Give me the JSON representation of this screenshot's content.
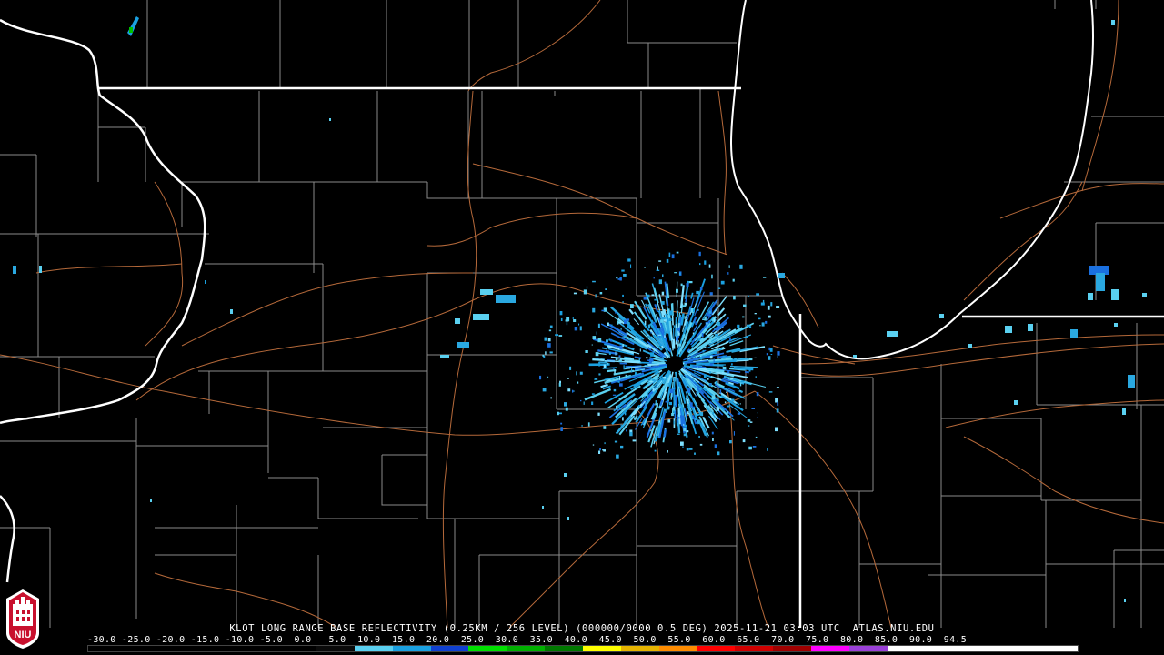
{
  "product": {
    "caption": "KLOT LONG RANGE BASE REFLECTIVITY (0.25KM / 256 LEVEL) (000000/0000 0.5 DEG) 2025-11-21 03:03 UTC  ATLAS.NIU.EDU"
  },
  "scale": {
    "labels_text": "-30.0 -25.0 -20.0 -15.0 -10.0 -5.0  0.0   5.0  10.0  15.0  20.0  25.0  30.0  35.0  40.0  45.0  50.0  55.0  60.0  65.0  70.0  75.0  80.0  85.0  90.0  94.5",
    "colors": [
      "#000000",
      "#000000",
      "#000000",
      "#000000",
      "#000000",
      "#000000",
      "#0a0a0a",
      "#5ad0f0",
      "#1aa0e0",
      "#1040d0",
      "#00e000",
      "#00b000",
      "#007800",
      "#ffff00",
      "#e6b400",
      "#ff8c00",
      "#ff0000",
      "#d00000",
      "#a00000",
      "#ff00ff",
      "#9a40d8",
      "#ffffff",
      "#ffffff",
      "#ffffff",
      "#ffffff",
      "#ffffff"
    ]
  },
  "logo": {
    "label": "NIU",
    "color": "#c8102e"
  }
}
